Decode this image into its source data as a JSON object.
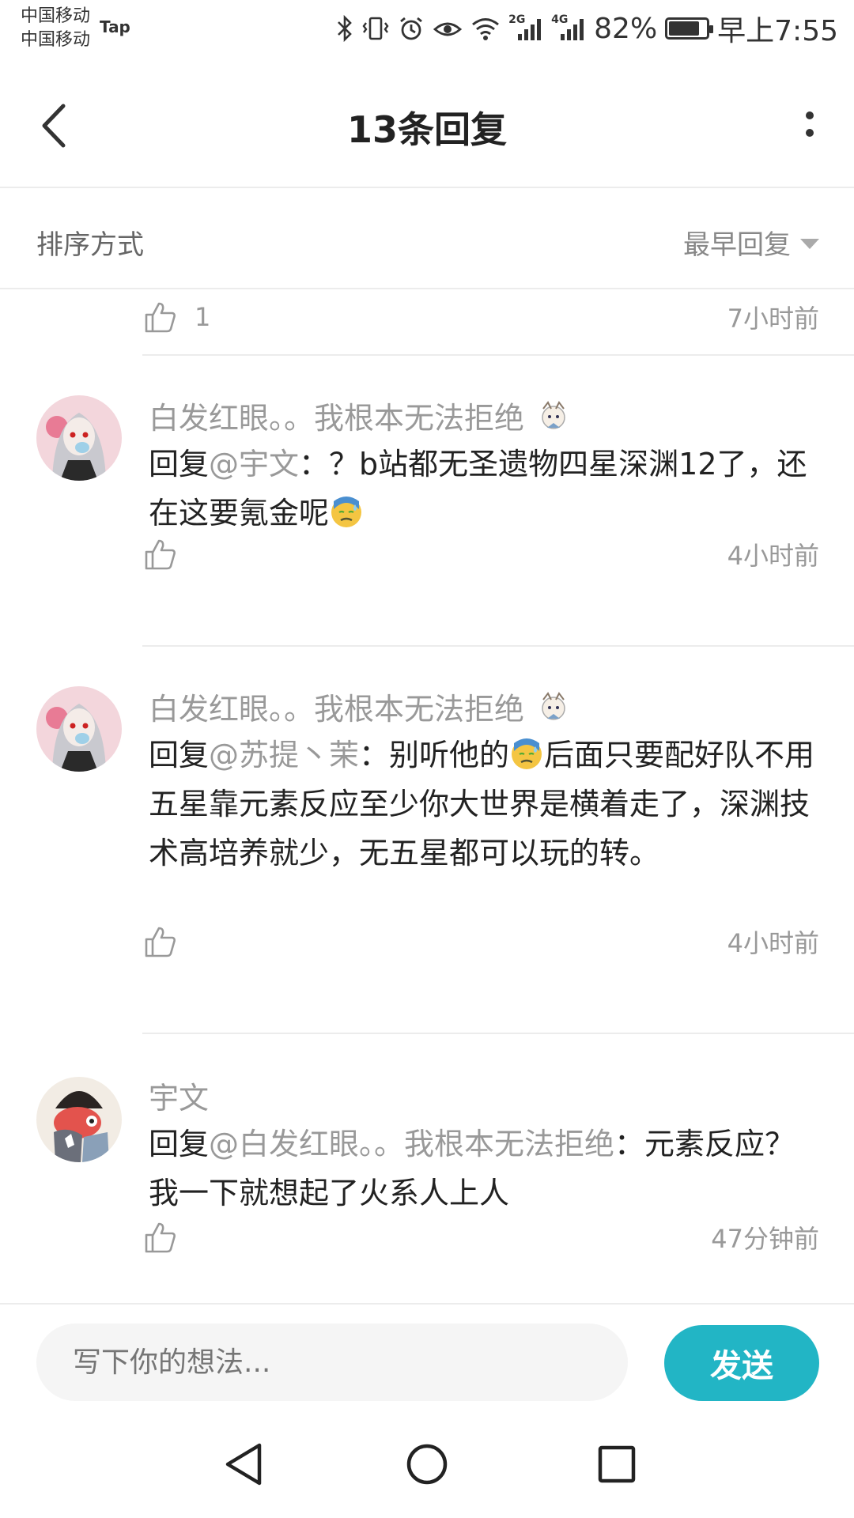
{
  "status_bar": {
    "carrier1": "中国移动",
    "carrier2": "中国移动",
    "app_tag": "Tap",
    "net1": "2G",
    "net2": "4G",
    "battery": "82%",
    "battery_level": 0.82,
    "time": "早上7:55"
  },
  "header": {
    "title": "13条回复"
  },
  "sort": {
    "label": "排序方式",
    "value": "最早回复"
  },
  "top_row": {
    "likes": "1",
    "time": "7小时前"
  },
  "comments": [
    {
      "user": "白发红眼。。我根本无法拒绝",
      "prefix": "回复",
      "mention": "@宇文",
      "text": "：？b站都无圣遗物四星深渊12了，还在这要氪金呢",
      "time": "4小时前"
    },
    {
      "user": "白发红眼。。我根本无法拒绝",
      "prefix": "回复",
      "mention": "@苏提丶茉",
      "text_a": "：别听他的",
      "text_b": "后面只要配好队不用五星靠元素反应至少你大世界是横着走了，深渊技术高培养就少，无五星都可以玩的转。",
      "time": "4小时前"
    },
    {
      "user": "宇文",
      "prefix": "回复",
      "mention": "@白发红眼。。我根本无法拒绝",
      "text": "：元素反应？我一下就想起了火系人上人",
      "time": "47分钟前"
    }
  ],
  "composer": {
    "placeholder": "写下你的想法...",
    "send_label": "发送"
  },
  "colors": {
    "accent": "#22b5c5",
    "muted_text": "#999999",
    "divider": "#ececec"
  }
}
